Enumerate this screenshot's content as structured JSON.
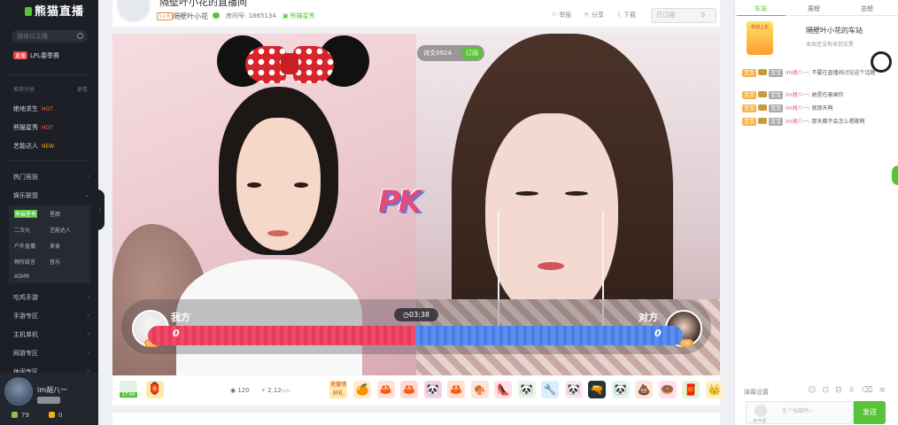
{
  "sidebar": {
    "logo": "熊猫直播",
    "search_placeholder": "搜综以主播",
    "live_badge": "直播",
    "lpl": "LPL春季赛",
    "recommend_heading": "推荐分类",
    "more": "更看",
    "hot_items": [
      {
        "label": "绝地求生",
        "tag": "HOT"
      },
      {
        "label": "熊猫星秀",
        "tag": "HOT"
      },
      {
        "label": "艺能达人",
        "tag": "NEW"
      }
    ],
    "categories": [
      "热门竞技",
      "娱乐联盟",
      "吃鸡手游",
      "手游专区",
      "主机单机",
      "网游专区",
      "休闲专区"
    ],
    "sub_items": [
      "熊猫星秀",
      "星颜",
      "二次元",
      "艺能达人",
      "户外直播",
      "美食",
      "畅所欲言",
      "音乐",
      "ASMR"
    ],
    "user": {
      "name": "lm胡八一",
      "bamboo": "79",
      "coins": "0"
    }
  },
  "header": {
    "title": "隔壁叶小花的直播间",
    "level": "Lv.6",
    "host": "隔壁叶小花",
    "room_no": "房间号: 1865134",
    "category": "熊猫星秀",
    "actions": [
      "举报",
      "分享",
      "下载"
    ],
    "subscribe_label": "已订阅",
    "subscribe_count": "0"
  },
  "video": {
    "host_tag": "诗文0924",
    "host_tag_btn": "订阅",
    "pk_label": "PK",
    "me_label": "我方",
    "opp_label": "对方",
    "timer": "03:38",
    "me_score": "0",
    "opp_score": "0",
    "me_mini": "0秒",
    "opp_mini": "0秒",
    "me_fraction": 0.5
  },
  "gifts": {
    "timer": "17:44",
    "view_count": "120",
    "bamboo": "2.12",
    "bamboo_unit": "mm",
    "recharge": "充值领好礼",
    "items": [
      {
        "icon": "🍊",
        "bg": "#ffecd0"
      },
      {
        "icon": "🦀",
        "bg": "#ffe2da"
      },
      {
        "icon": "🦀",
        "bg": "#ffd9d3"
      },
      {
        "icon": "🐼",
        "bg": "#f7d0e6"
      },
      {
        "icon": "🦀",
        "bg": "#ffe0d4"
      },
      {
        "icon": "🍖",
        "bg": "#ffe3d7"
      },
      {
        "icon": "👠",
        "bg": "#ffdfe8"
      },
      {
        "icon": "🐼",
        "bg": "#e8f5e9"
      },
      {
        "icon": "🔧",
        "bg": "#dbeefb"
      },
      {
        "icon": "🐼",
        "bg": "#fde4ef"
      },
      {
        "icon": "🔫",
        "bg": "#263238"
      },
      {
        "icon": "🐼",
        "bg": "#e0f7ef"
      },
      {
        "icon": "💩",
        "bg": "#fde5d9"
      },
      {
        "icon": "🍩",
        "bg": "#ffe0ec"
      },
      {
        "icon": "🧧",
        "bg": "#dff5d5"
      },
      {
        "icon": "👑",
        "bg": "#fff1c4"
      }
    ]
  },
  "chat": {
    "tabs": [
      "车站",
      "周榜",
      "总榜"
    ],
    "station_badge": "欢迎上车",
    "station_title": "隔壁叶小花的车站",
    "station_sub": "本周还没有收到车票",
    "badge_a": "宝宝",
    "badge_c": "宝宝",
    "messages": [
      {
        "name": "lm胡八一",
        "text": "不要在直播间讨论这个话题"
      },
      {
        "name": "lm胡八一",
        "text": "她是在泰国你"
      },
      {
        "name": "lm胡八一",
        "text": "就那天啊"
      },
      {
        "name": "lm胡八一",
        "text": "那天都不会怎么唱歌啊"
      }
    ],
    "settings": "弹幕设置",
    "input_placeholder": "全个弹幕吧~",
    "unlogged": "未开通",
    "send": "发送"
  }
}
